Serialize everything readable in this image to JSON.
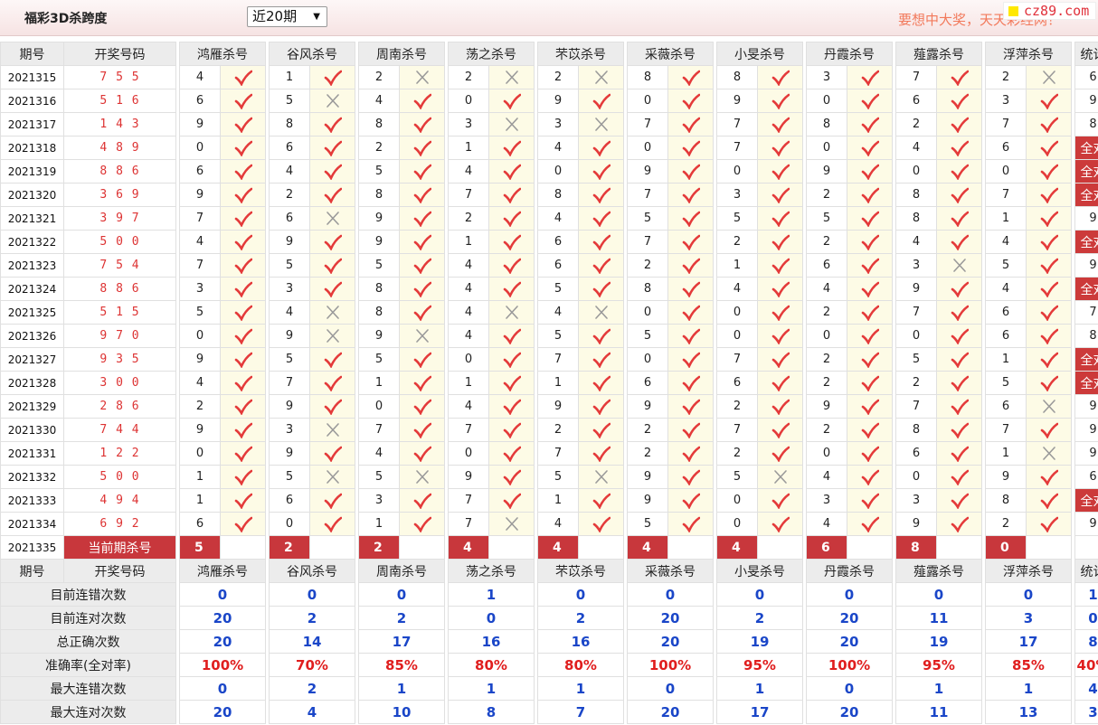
{
  "header": {
    "title": "福彩3D杀跨度",
    "period_select": "近20期",
    "slogan": "要想中大奖，天天彩经网！",
    "logo": "cz89.com"
  },
  "columns": {
    "period": "期号",
    "winning": "开奖号码",
    "experts": [
      "鸿雁杀号",
      "谷风杀号",
      "周南杀号",
      "荡之杀号",
      "芣苡杀号",
      "采薇杀号",
      "小旻杀号",
      "丹霞杀号",
      "薤露杀号",
      "浮萍杀号"
    ],
    "stats": "统计"
  },
  "rows": [
    {
      "period": "2021315",
      "winning": "7 5 5",
      "picks": [
        4,
        1,
        2,
        2,
        2,
        8,
        8,
        3,
        7,
        2
      ],
      "hits": [
        1,
        1,
        0,
        0,
        0,
        1,
        1,
        1,
        1,
        0
      ],
      "stat": "6"
    },
    {
      "period": "2021316",
      "winning": "5 1 6",
      "picks": [
        6,
        5,
        4,
        0,
        9,
        0,
        9,
        0,
        6,
        3
      ],
      "hits": [
        1,
        0,
        1,
        1,
        1,
        1,
        1,
        1,
        1,
        1
      ],
      "stat": "9"
    },
    {
      "period": "2021317",
      "winning": "1 4 3",
      "picks": [
        9,
        8,
        8,
        3,
        3,
        7,
        7,
        8,
        2,
        7
      ],
      "hits": [
        1,
        1,
        1,
        0,
        0,
        1,
        1,
        1,
        1,
        1
      ],
      "stat": "8"
    },
    {
      "period": "2021318",
      "winning": "4 8 9",
      "picks": [
        0,
        6,
        2,
        1,
        4,
        0,
        7,
        0,
        4,
        6
      ],
      "hits": [
        1,
        1,
        1,
        1,
        1,
        1,
        1,
        1,
        1,
        1
      ],
      "stat": "全对"
    },
    {
      "period": "2021319",
      "winning": "8 8 6",
      "picks": [
        6,
        4,
        5,
        4,
        0,
        9,
        0,
        9,
        0,
        0
      ],
      "hits": [
        1,
        1,
        1,
        1,
        1,
        1,
        1,
        1,
        1,
        1
      ],
      "stat": "全对"
    },
    {
      "period": "2021320",
      "winning": "3 6 9",
      "picks": [
        9,
        2,
        8,
        7,
        8,
        7,
        3,
        2,
        8,
        7
      ],
      "hits": [
        1,
        1,
        1,
        1,
        1,
        1,
        1,
        1,
        1,
        1
      ],
      "stat": "全对"
    },
    {
      "period": "2021321",
      "winning": "3 9 7",
      "picks": [
        7,
        6,
        9,
        2,
        4,
        5,
        5,
        5,
        8,
        1
      ],
      "hits": [
        1,
        0,
        1,
        1,
        1,
        1,
        1,
        1,
        1,
        1
      ],
      "stat": "9"
    },
    {
      "period": "2021322",
      "winning": "5 0 0",
      "picks": [
        4,
        9,
        9,
        1,
        6,
        7,
        2,
        2,
        4,
        4
      ],
      "hits": [
        1,
        1,
        1,
        1,
        1,
        1,
        1,
        1,
        1,
        1
      ],
      "stat": "全对"
    },
    {
      "period": "2021323",
      "winning": "7 5 4",
      "picks": [
        7,
        5,
        5,
        4,
        6,
        2,
        1,
        6,
        3,
        5
      ],
      "hits": [
        1,
        1,
        1,
        1,
        1,
        1,
        1,
        1,
        0,
        1
      ],
      "stat": "9"
    },
    {
      "period": "2021324",
      "winning": "8 8 6",
      "picks": [
        3,
        3,
        8,
        4,
        5,
        8,
        4,
        4,
        9,
        4
      ],
      "hits": [
        1,
        1,
        1,
        1,
        1,
        1,
        1,
        1,
        1,
        1
      ],
      "stat": "全对"
    },
    {
      "period": "2021325",
      "winning": "5 1 5",
      "picks": [
        5,
        4,
        8,
        4,
        4,
        0,
        0,
        2,
        7,
        6
      ],
      "hits": [
        1,
        0,
        1,
        0,
        0,
        1,
        1,
        1,
        1,
        1
      ],
      "stat": "7"
    },
    {
      "period": "2021326",
      "winning": "9 7 0",
      "picks": [
        0,
        9,
        9,
        4,
        5,
        5,
        0,
        0,
        0,
        6
      ],
      "hits": [
        1,
        0,
        0,
        1,
        1,
        1,
        1,
        1,
        1,
        1
      ],
      "stat": "8"
    },
    {
      "period": "2021327",
      "winning": "9 3 5",
      "picks": [
        9,
        5,
        5,
        0,
        7,
        0,
        7,
        2,
        5,
        1
      ],
      "hits": [
        1,
        1,
        1,
        1,
        1,
        1,
        1,
        1,
        1,
        1
      ],
      "stat": "全对"
    },
    {
      "period": "2021328",
      "winning": "3 0 0",
      "picks": [
        4,
        7,
        1,
        1,
        1,
        6,
        6,
        2,
        2,
        5
      ],
      "hits": [
        1,
        1,
        1,
        1,
        1,
        1,
        1,
        1,
        1,
        1
      ],
      "stat": "全对"
    },
    {
      "period": "2021329",
      "winning": "2 8 6",
      "picks": [
        2,
        9,
        0,
        4,
        9,
        9,
        2,
        9,
        7,
        6
      ],
      "hits": [
        1,
        1,
        1,
        1,
        1,
        1,
        1,
        1,
        1,
        0
      ],
      "stat": "9"
    },
    {
      "period": "2021330",
      "winning": "7 4 4",
      "picks": [
        9,
        3,
        7,
        7,
        2,
        2,
        7,
        2,
        8,
        7
      ],
      "hits": [
        1,
        0,
        1,
        1,
        1,
        1,
        1,
        1,
        1,
        1
      ],
      "stat": "9"
    },
    {
      "period": "2021331",
      "winning": "1 2 2",
      "picks": [
        0,
        9,
        4,
        0,
        7,
        2,
        2,
        0,
        6,
        1
      ],
      "hits": [
        1,
        1,
        1,
        1,
        1,
        1,
        1,
        1,
        1,
        0
      ],
      "stat": "9"
    },
    {
      "period": "2021332",
      "winning": "5 0 0",
      "picks": [
        1,
        5,
        5,
        9,
        5,
        9,
        5,
        4,
        0,
        9
      ],
      "hits": [
        1,
        0,
        0,
        1,
        0,
        1,
        0,
        1,
        1,
        1
      ],
      "stat": "6"
    },
    {
      "period": "2021333",
      "winning": "4 9 4",
      "picks": [
        1,
        6,
        3,
        7,
        1,
        9,
        0,
        3,
        3,
        8
      ],
      "hits": [
        1,
        1,
        1,
        1,
        1,
        1,
        1,
        1,
        1,
        1
      ],
      "stat": "全对"
    },
    {
      "period": "2021334",
      "winning": "6 9 2",
      "picks": [
        6,
        0,
        1,
        7,
        4,
        5,
        0,
        4,
        9,
        2
      ],
      "hits": [
        1,
        1,
        1,
        0,
        1,
        1,
        1,
        1,
        1,
        1
      ],
      "stat": "9"
    }
  ],
  "current": {
    "period": "2021335",
    "label": "当前期杀号",
    "picks": [
      "5",
      "2",
      "2",
      "4",
      "4",
      "4",
      "4",
      "6",
      "8",
      "0"
    ]
  },
  "summary": [
    {
      "label": "目前连错次数",
      "values": [
        "0",
        "0",
        "0",
        "1",
        "0",
        "0",
        "0",
        "0",
        "0",
        "0"
      ],
      "stat": "1",
      "style": "blue"
    },
    {
      "label": "目前连对次数",
      "values": [
        "20",
        "2",
        "2",
        "0",
        "2",
        "20",
        "2",
        "20",
        "11",
        "3"
      ],
      "stat": "0",
      "style": "blue"
    },
    {
      "label": "总正确次数",
      "values": [
        "20",
        "14",
        "17",
        "16",
        "16",
        "20",
        "19",
        "20",
        "19",
        "17"
      ],
      "stat": "8",
      "style": "blue"
    },
    {
      "label": "准确率(全对率)",
      "values": [
        "100%",
        "70%",
        "85%",
        "80%",
        "80%",
        "100%",
        "95%",
        "100%",
        "95%",
        "85%"
      ],
      "stat": "40%",
      "style": "red"
    },
    {
      "label": "最大连错次数",
      "values": [
        "0",
        "2",
        "1",
        "1",
        "1",
        "0",
        "1",
        "0",
        "1",
        "1"
      ],
      "stat": "4",
      "style": "blue"
    },
    {
      "label": "最大连对次数",
      "values": [
        "20",
        "4",
        "10",
        "8",
        "7",
        "20",
        "17",
        "20",
        "11",
        "13"
      ],
      "stat": "3",
      "style": "blue"
    }
  ],
  "colors": {
    "hit": "#e43a3a",
    "miss": "#9a9a9a",
    "all_correct_bg": "#cc3a3a",
    "current_bg": "#c8373c",
    "summary_blue": "#1a46c8",
    "summary_red": "#e01e1e"
  }
}
